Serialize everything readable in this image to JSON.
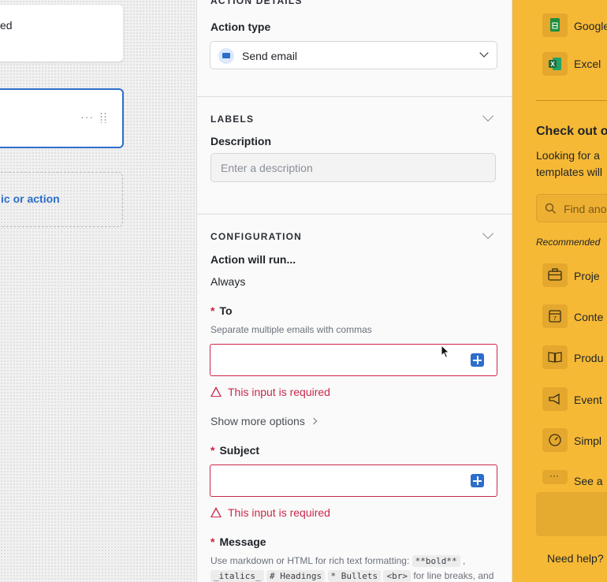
{
  "canvas": {
    "top_card_text": "ed",
    "add_card_text": "ic or action"
  },
  "action_details": {
    "section_title": "ACTION DETAILS",
    "action_type_label": "Action type",
    "action_type_value": "Send email"
  },
  "labels_section": {
    "section_title": "LABELS",
    "description_label": "Description",
    "description_placeholder": "Enter a description"
  },
  "configuration": {
    "section_title": "CONFIGURATION",
    "run_label": "Action will run...",
    "run_value": "Always",
    "to_required": "*",
    "to_label": "To",
    "to_help": "Separate multiple emails with commas",
    "to_error": "This input is required",
    "show_more": "Show more options",
    "subject_required": "*",
    "subject_label": "Subject",
    "subject_error": "This input is required",
    "message_required": "*",
    "message_label": "Message",
    "message_hint_prefix": "Use markdown or HTML for rich text formatting:",
    "code_bold": "**bold**",
    "code_italics": "_italics_",
    "code_headings": "# Headings",
    "code_bullets": "* Bullets",
    "code_br": "<br>",
    "message_hint_suffix": "for line breaks, and"
  },
  "sidebar": {
    "integrations": [
      {
        "label": "Google",
        "icon": "google-sheets-icon",
        "color": "#1e8e3e"
      },
      {
        "label": "Excel",
        "icon": "excel-icon",
        "color": "#1d6f42"
      }
    ],
    "heading": "Check out o",
    "desc_line1": "Looking for a",
    "desc_line2": "templates will",
    "search_placeholder": "Find ano",
    "recommended_label": "Recommended",
    "templates": [
      {
        "label": "Proje",
        "icon": "briefcase-icon"
      },
      {
        "label": "Conte",
        "icon": "calendar-icon"
      },
      {
        "label": "Produ",
        "icon": "book-icon"
      },
      {
        "label": "Event",
        "icon": "megaphone-icon"
      },
      {
        "label": "Simpl",
        "icon": "gauge-icon"
      },
      {
        "label": "See a",
        "icon": "more-icon"
      }
    ],
    "help_text": "Need help?"
  }
}
